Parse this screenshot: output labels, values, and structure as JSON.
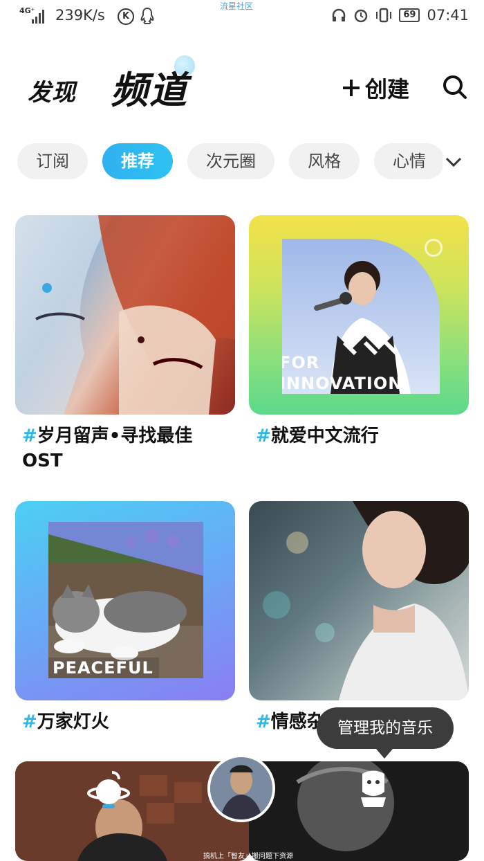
{
  "status_bar": {
    "network": "4G⁺",
    "speed": "239K/s",
    "k_badge": "K",
    "battery": "69",
    "time": "07:41",
    "watermark": "流星社区"
  },
  "header": {
    "discover": "发现",
    "channel": "频道",
    "create_label": "创建"
  },
  "tabs": [
    {
      "label": "订阅",
      "active": false
    },
    {
      "label": "推荐",
      "active": true
    },
    {
      "label": "次元圈",
      "active": false
    },
    {
      "label": "风格",
      "active": false
    },
    {
      "label": "心情",
      "active": false
    }
  ],
  "cards": [
    {
      "hash": "#",
      "title": "岁月留声•寻找最佳OST"
    },
    {
      "hash": "#",
      "title": "就爱中文流行",
      "overlay": "FOR INNOVATION"
    },
    {
      "hash": "#",
      "title": "万家灯火",
      "overlay": "PEACEFUL"
    },
    {
      "hash": "#",
      "title": "情感杂货铺"
    }
  ],
  "bottom": {
    "tooltip": "管理我的音乐",
    "footnote": "搞机上「智友」搬问题下资源"
  },
  "icons": {
    "search": "search-icon",
    "plus": "plus-icon",
    "chevron": "chevron-down-icon",
    "planet": "planet-icon",
    "robot": "robot-icon"
  }
}
